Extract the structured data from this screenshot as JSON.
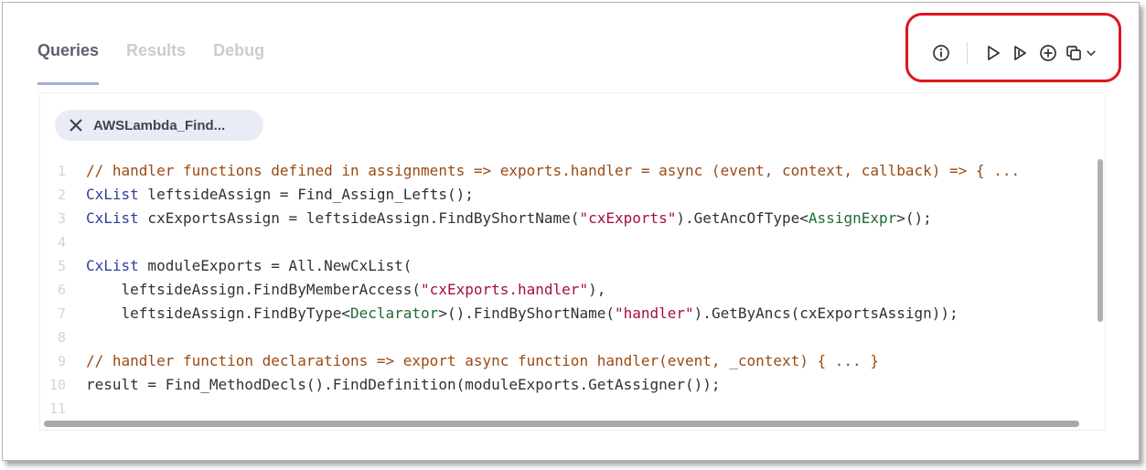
{
  "tabs": [
    {
      "label": "Queries",
      "active": true
    },
    {
      "label": "Results",
      "active": false
    },
    {
      "label": "Debug",
      "active": false
    }
  ],
  "toolbar": {
    "icons": [
      "info-icon",
      "run-icon",
      "run-selected-icon",
      "add-icon",
      "copy-icon",
      "chevron-down-icon"
    ],
    "highlight_color": "#e0141e"
  },
  "query_chip": {
    "label": "AWSLambda_Find...",
    "icon": "close-icon"
  },
  "editor": {
    "lines": [
      {
        "n": "1",
        "tokens": [
          {
            "t": "// handler functions defined in assignments => exports.handler = async (event, context, callback) => { ...",
            "c": "cm"
          }
        ]
      },
      {
        "n": "2",
        "tokens": [
          {
            "t": "CxList",
            "c": "kw"
          },
          {
            "t": " leftsideAssign = Find_Assign_Lefts();",
            "c": ""
          }
        ]
      },
      {
        "n": "3",
        "tokens": [
          {
            "t": "CxList",
            "c": "kw"
          },
          {
            "t": " cxExportsAssign = leftsideAssign.FindByShortName(",
            "c": ""
          },
          {
            "t": "\"cxExports\"",
            "c": "str"
          },
          {
            "t": ").GetAncOfType<",
            "c": ""
          },
          {
            "t": "AssignExpr",
            "c": "ty"
          },
          {
            "t": ">();",
            "c": ""
          }
        ]
      },
      {
        "n": "4",
        "tokens": []
      },
      {
        "n": "5",
        "tokens": [
          {
            "t": "CxList",
            "c": "kw"
          },
          {
            "t": " moduleExports = All.NewCxList(",
            "c": ""
          }
        ]
      },
      {
        "n": "6",
        "tokens": [
          {
            "t": "    leftsideAssign.FindByMemberAccess(",
            "c": ""
          },
          {
            "t": "\"cxExports.handler\"",
            "c": "str"
          },
          {
            "t": "),",
            "c": ""
          }
        ]
      },
      {
        "n": "7",
        "tokens": [
          {
            "t": "    leftsideAssign.FindByType<",
            "c": ""
          },
          {
            "t": "Declarator",
            "c": "ty"
          },
          {
            "t": ">().FindByShortName(",
            "c": ""
          },
          {
            "t": "\"handler\"",
            "c": "str"
          },
          {
            "t": ").GetByAncs(cxExportsAssign));",
            "c": ""
          }
        ]
      },
      {
        "n": "8",
        "tokens": []
      },
      {
        "n": "9",
        "tokens": [
          {
            "t": "// handler function declarations => export async function handler(event, _context) { ... }",
            "c": "cm"
          }
        ]
      },
      {
        "n": "10",
        "tokens": [
          {
            "t": "result = Find_MethodDecls().FindDefinition(moduleExports.GetAssigner());",
            "c": ""
          }
        ]
      },
      {
        "n": "11",
        "tokens": []
      }
    ]
  }
}
